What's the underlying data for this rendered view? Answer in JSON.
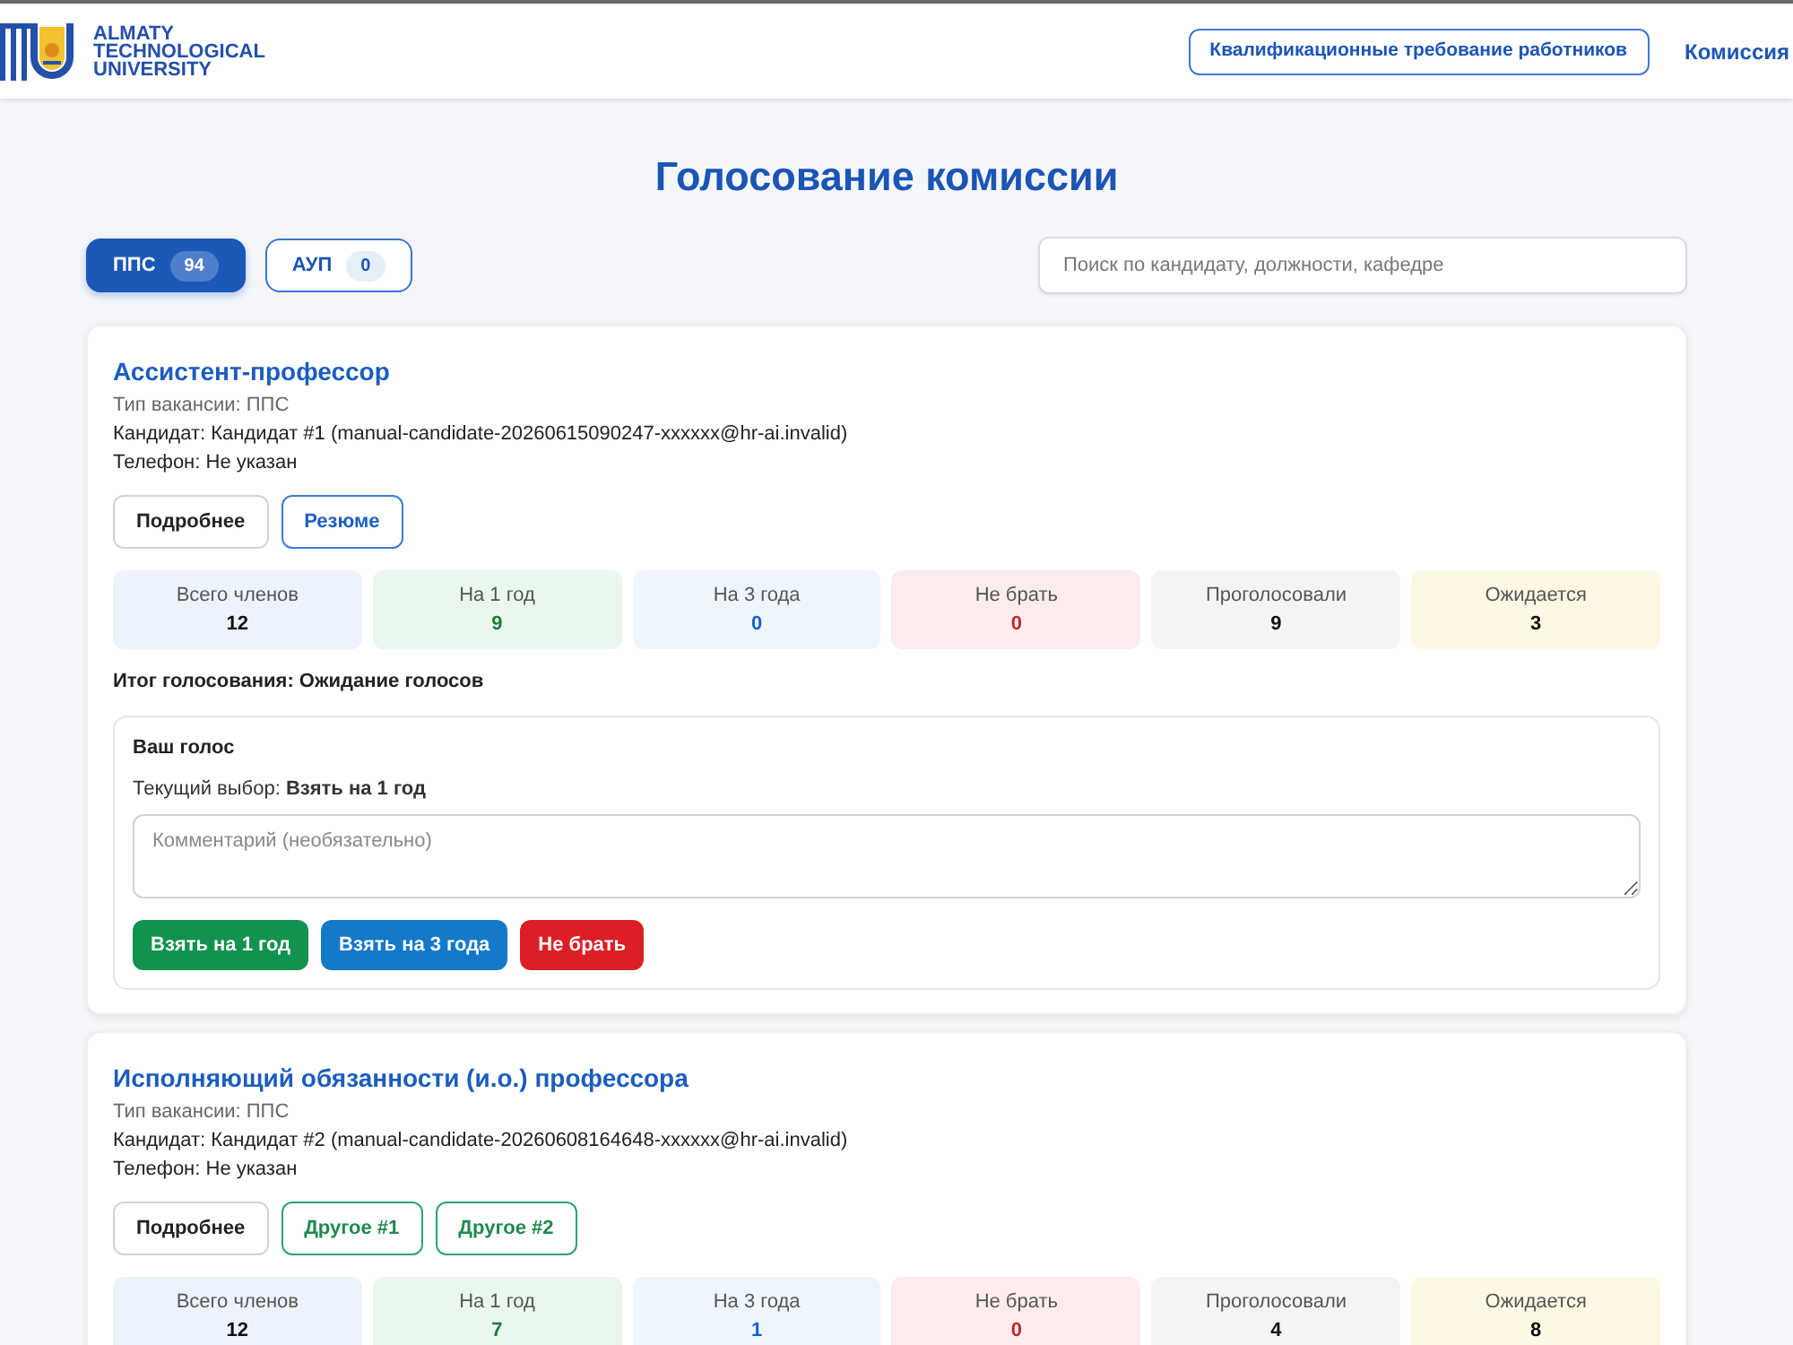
{
  "header": {
    "logo_lines": [
      "ALMATY",
      "TECHNOLOGICAL",
      "UNIVERSITY"
    ],
    "nav": [
      {
        "label": "Квалификационные требование работников",
        "kind": "outlined"
      },
      {
        "label": "Комиссия",
        "kind": "link"
      }
    ]
  },
  "page_title": "Голосование комиссии",
  "tabs": [
    {
      "label": "ППС",
      "count": "94",
      "selected": true
    },
    {
      "label": "АУП",
      "count": "0",
      "selected": false
    }
  ],
  "search": {
    "placeholder": "Поиск по кандидату, должности, кафедре"
  },
  "vacancies": [
    {
      "title": "Ассистент-профессор",
      "type_line": "Тип вакансии: ППС",
      "candidate_line": "Кандидат: Кандидат #1 (manual-candidate-20260615090247-xxxxxx@hr-ai.invalid)",
      "phone_line": "Телефон: Не указан",
      "actions": [
        {
          "label": "Подробнее",
          "kind": "details"
        },
        {
          "label": "Резюме",
          "kind": "resume"
        }
      ],
      "stats": [
        {
          "label": "Всего членов",
          "value": "12",
          "kind": "total"
        },
        {
          "label": "На 1 год",
          "value": "9",
          "kind": "year1"
        },
        {
          "label": "На 3 года",
          "value": "0",
          "kind": "year3"
        },
        {
          "label": "Не брать",
          "value": "0",
          "kind": "reject"
        },
        {
          "label": "Проголосовали",
          "value": "9",
          "kind": "voted"
        },
        {
          "label": "Ожидается",
          "value": "3",
          "kind": "pending"
        }
      ],
      "result": "Итог голосования: Ожидание голосов",
      "vote": {
        "heading": "Ваш голос",
        "current": "Текущий выбор: **Взять на 1 год**",
        "comment_placeholder": "Комментарий (необязательно)",
        "buttons": [
          {
            "label": "Взять на 1 год",
            "kind": "year1"
          },
          {
            "label": "Взять на 3 года",
            "kind": "year3"
          },
          {
            "label": "Не брать",
            "kind": "reject"
          }
        ]
      }
    },
    {
      "title": "Исполняющий обязанности (и.о.) профессора",
      "type_line": "Тип вакансии: ППС",
      "candidate_line": "Кандидат: Кандидат #2 (manual-candidate-20260608164648-xxxxxx@hr-ai.invalid)",
      "phone_line": "Телефон: Не указан",
      "actions": [
        {
          "label": "Подробнее",
          "kind": "details"
        },
        {
          "label": "Другое #1",
          "kind": "other"
        },
        {
          "label": "Другое #2",
          "kind": "other"
        }
      ],
      "stats": [
        {
          "label": "Всего членов",
          "value": "12",
          "kind": "total"
        },
        {
          "label": "На 1 год",
          "value": "7",
          "kind": "year1"
        },
        {
          "label": "На 3 года",
          "value": "1",
          "kind": "year3"
        },
        {
          "label": "Не брать",
          "value": "0",
          "kind": "reject"
        },
        {
          "label": "Проголосовали",
          "value": "4",
          "kind": "voted"
        },
        {
          "label": "Ожидается",
          "value": "8",
          "kind": "pending"
        }
      ]
    }
  ]
}
